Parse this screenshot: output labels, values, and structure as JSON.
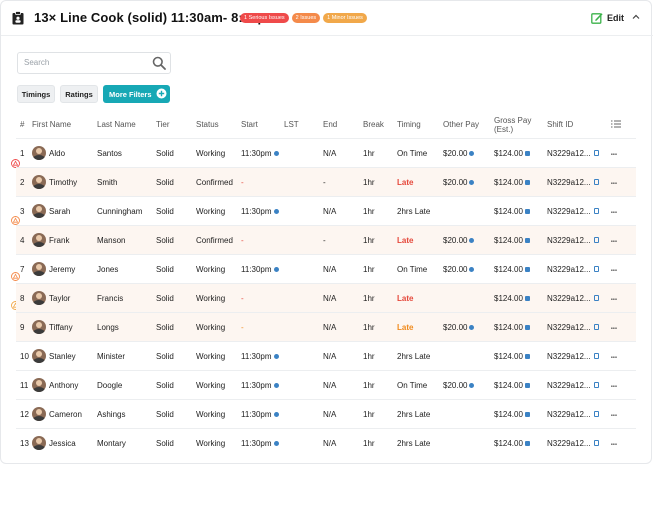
{
  "header": {
    "title": "13× Line Cook (solid) 11:30am- 8:30pm",
    "badges": [
      {
        "label": "1 Serious Issues",
        "color": "#ef4a4a"
      },
      {
        "label": "2 Issues",
        "color": "#f48a4a"
      },
      {
        "label": "1 Minor Issues",
        "color": "#f1a84a"
      }
    ],
    "edit_label": "Edit"
  },
  "search": {
    "placeholder": "Search",
    "value": ""
  },
  "filters": {
    "timings": "Timings",
    "ratings": "Ratings",
    "more": "More Filters"
  },
  "columns": {
    "num": "#",
    "first": "First Name",
    "last": "Last Name",
    "tier": "Tier",
    "status": "Status",
    "start": "Start",
    "lst": "LST",
    "end": "End",
    "break": "Break",
    "timing": "Timing",
    "other": "Other Pay",
    "gross": "Gross Pay (Est.)",
    "shift": "Shift ID"
  },
  "rows": [
    {
      "num": "1",
      "first": "Aldo",
      "last": "Santos",
      "tier": "Solid",
      "status": "Working",
      "start": "11:30pm",
      "lst": "",
      "end": "N/A",
      "brk": "1hr",
      "timing": "On Time",
      "other": "$20.00",
      "gross": "$124.00",
      "shift": "N3229a12..."
    },
    {
      "num": "2",
      "first": "Timothy",
      "last": "Smith",
      "tier": "Solid",
      "status": "Confirmed",
      "start": "-",
      "lst": "",
      "end": "-",
      "brk": "1hr",
      "timing": "Late",
      "other": "$20.00",
      "gross": "$124.00",
      "shift": "N3229a12..."
    },
    {
      "num": "3",
      "first": "Sarah",
      "last": "Cunningham",
      "tier": "Solid",
      "status": "Working",
      "start": "11:30pm",
      "lst": "",
      "end": "N/A",
      "brk": "1hr",
      "timing": "2hrs Late",
      "other": "",
      "gross": "$124.00",
      "shift": "N3229a12..."
    },
    {
      "num": "4",
      "first": "Frank",
      "last": "Manson",
      "tier": "Solid",
      "status": "Confirmed",
      "start": "-",
      "lst": "",
      "end": "-",
      "brk": "1hr",
      "timing": "Late",
      "other": "$20.00",
      "gross": "$124.00",
      "shift": "N3229a12..."
    },
    {
      "num": "7",
      "first": "Jeremy",
      "last": "Jones",
      "tier": "Solid",
      "status": "Working",
      "start": "11:30pm",
      "lst": "",
      "end": "N/A",
      "brk": "1hr",
      "timing": "On Time",
      "other": "$20.00",
      "gross": "$124.00",
      "shift": "N3229a12..."
    },
    {
      "num": "8",
      "first": "Taylor",
      "last": "Francis",
      "tier": "Solid",
      "status": "Working",
      "start": "-",
      "lst": "",
      "end": "N/A",
      "brk": "1hr",
      "timing": "Late",
      "other": "",
      "gross": "$124.00",
      "shift": "N3229a12..."
    },
    {
      "num": "9",
      "first": "Tiffany",
      "last": "Longs",
      "tier": "Solid",
      "status": "Working",
      "start": "-",
      "lst": "",
      "end": "N/A",
      "brk": "1hr",
      "timing": "Late",
      "other": "$20.00",
      "gross": "$124.00",
      "shift": "N3229a12..."
    },
    {
      "num": "10",
      "first": "Stanley",
      "last": "Minister",
      "tier": "Solid",
      "status": "Working",
      "start": "11:30pm",
      "lst": "",
      "end": "N/A",
      "brk": "1hr",
      "timing": "2hrs Late",
      "other": "",
      "gross": "$124.00",
      "shift": "N3229a12..."
    },
    {
      "num": "11",
      "first": "Anthony",
      "last": "Doogle",
      "tier": "Solid",
      "status": "Working",
      "start": "11:30pm",
      "lst": "",
      "end": "N/A",
      "brk": "1hr",
      "timing": "On Time",
      "other": "$20.00",
      "gross": "$124.00",
      "shift": "N3229a12..."
    },
    {
      "num": "12",
      "first": "Cameron",
      "last": "Ashings",
      "tier": "Solid",
      "status": "Working",
      "start": "11:30pm",
      "lst": "",
      "end": "N/A",
      "brk": "1hr",
      "timing": "2hrs Late",
      "other": "",
      "gross": "$124.00",
      "shift": "N3229a12..."
    },
    {
      "num": "13",
      "first": "Jessica",
      "last": "Montary",
      "tier": "Solid",
      "status": "Working",
      "start": "11:30pm",
      "lst": "",
      "end": "N/A",
      "brk": "1hr",
      "timing": "2hrs Late",
      "other": "",
      "gross": "$124.00",
      "shift": "N3229a12..."
    }
  ]
}
